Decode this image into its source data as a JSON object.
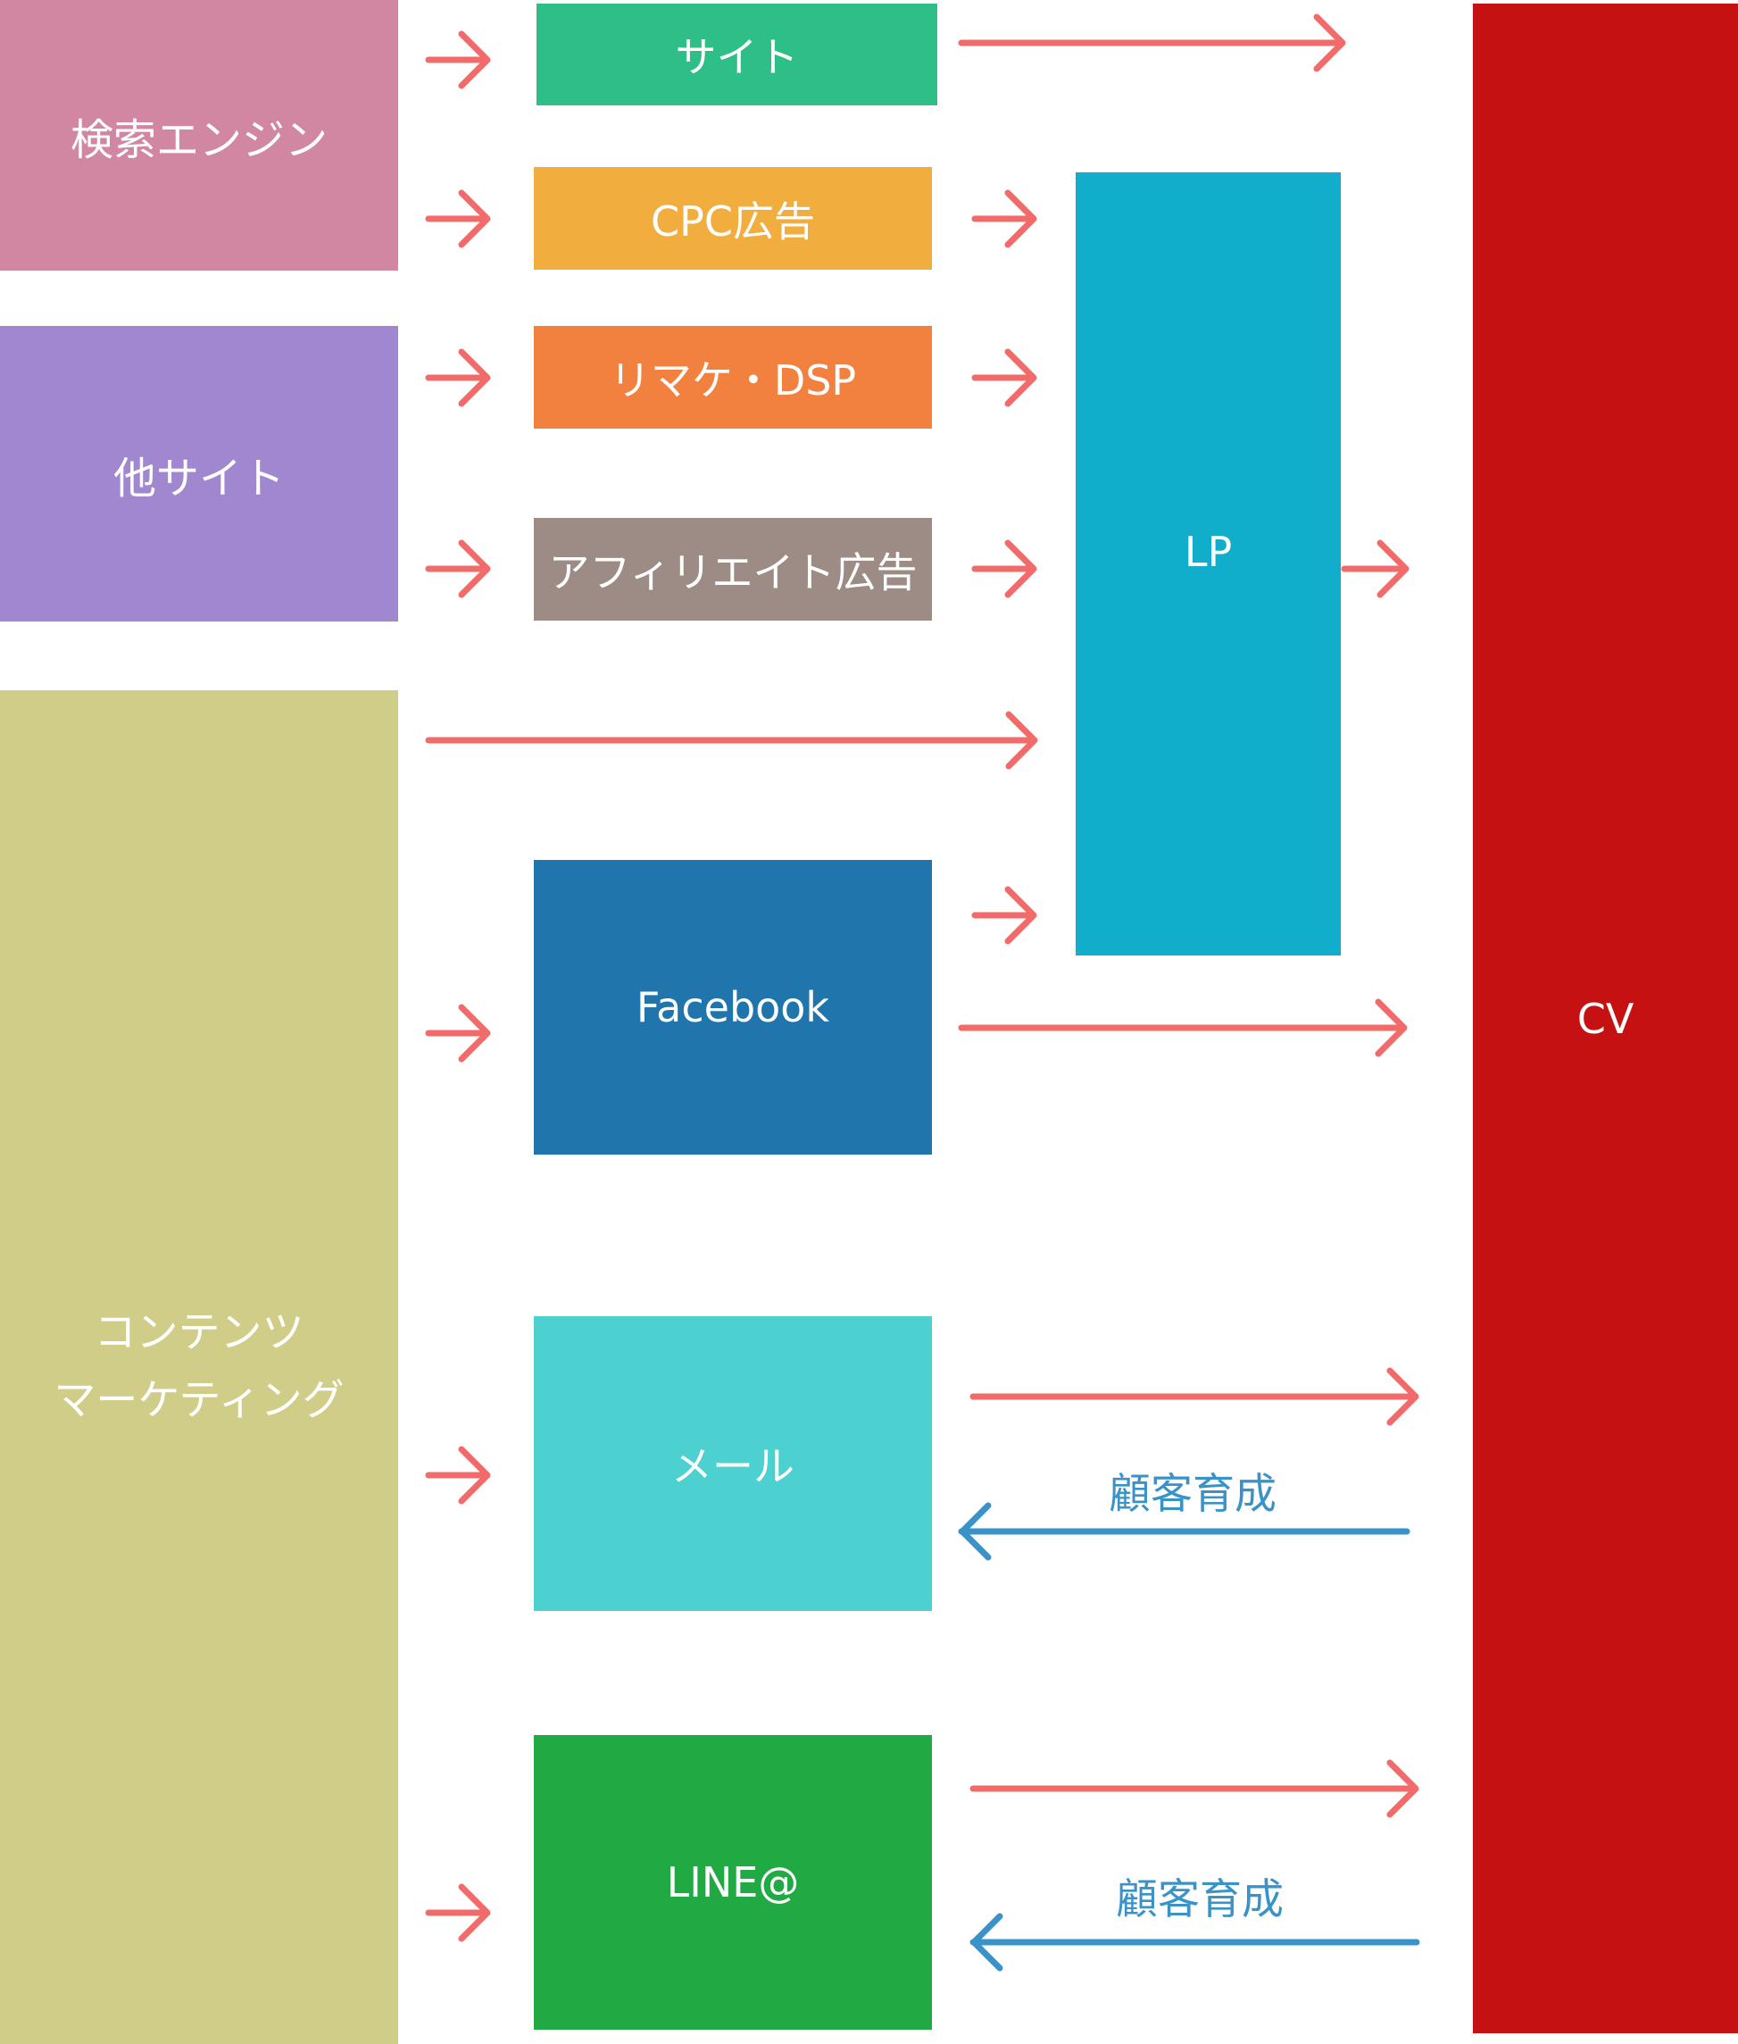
{
  "colors": {
    "flow_arrow": "#f16b6b",
    "nurture_arrow": "#3a93c8",
    "search_engine": "#d186a2",
    "other_sites": "#a087cf",
    "content_marketing": "#d0cd88",
    "site": "#2ebf89",
    "cpc": "#f1ad3e",
    "remarketing": "#f2803f",
    "affiliate": "#9c8c85",
    "facebook": "#2076ac",
    "mail": "#4dd0d0",
    "line": "#21aa44",
    "lp": "#10aecb",
    "cv": "#c51111"
  },
  "sources": {
    "search_engine": "検索エンジン",
    "other_sites": "他サイト",
    "content_marketing": "コンテンツ\nマーケティング"
  },
  "channels": {
    "site": "サイト",
    "cpc": "CPC広告",
    "remarketing": "リマケ・DSP",
    "affiliate": "アフィリエイト広告",
    "facebook": "Facebook",
    "mail": "メール",
    "line": "LINE@"
  },
  "targets": {
    "lp": "LP",
    "cv": "CV"
  },
  "captions": {
    "nurture_mail": "顧客育成",
    "nurture_line": "顧客育成"
  }
}
